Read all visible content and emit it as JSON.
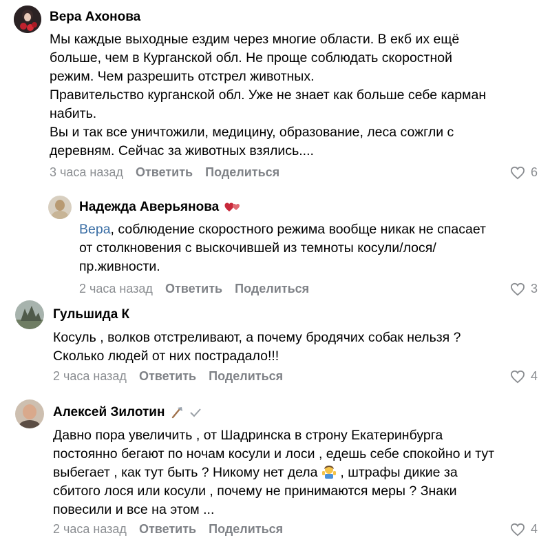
{
  "comments": [
    {
      "author": "Вера Ахонова",
      "lines": [
        "Мы каждые выходные ездим через многие области. В екб их ещё",
        "больше, чем в Курганской обл. Не проще соблюдать скоростной",
        "режим. Чем разрешить отстрел животных.",
        "Правительство курганской обл. Уже не знает как больше себе карман",
        "набить.",
        "Вы и так все уничтожили, медицину, образование, леса сожгли с",
        "деревням. Сейчас за животных взялись...."
      ],
      "time": "3 часа назад",
      "reply": "Ответить",
      "share": "Поделиться",
      "likes": "6"
    },
    {
      "author": "Надежда Аверьянова",
      "mention": "Вера",
      "lines": [
        ", соблюдение скоростного режима вообще никак не спасает",
        "от столкновения с выскочившей из темноты косули/лося/",
        "пр.живности."
      ],
      "time": "2 часа назад",
      "reply": "Ответить",
      "share": "Поделиться",
      "likes": "3",
      "badge_icon": "hearts-icon"
    },
    {
      "author": "Гульшида К",
      "lines": [
        "Косуль , волков отстреливают, а почему бродячих собак нельзя ?",
        "Сколько людей от них пострадало!!!"
      ],
      "time": "2 часа назад",
      "reply": "Ответить",
      "share": "Поделиться",
      "likes": "4"
    },
    {
      "author": "Алексей Зилотин",
      "lines": [
        "Давно пора увеличить , от Шадринска в строну Екатеринбурга",
        "постоянно бегают по ночам косули и лоси , едешь себе спокойно и тут",
        "выбегает , как тут быть ? Никому нет дела",
        "сбитого лося или косули , почему не принимаются меры ? Знаки",
        "повесили и все на этом ..."
      ],
      "line3_suffix": ", штрафы дикие за",
      "time": "2 часа назад",
      "reply": "Ответить",
      "share": "Поделиться",
      "likes": "4",
      "badge_icon": "axe-icon",
      "verified_icon": "checkmark-icon"
    }
  ],
  "colors": {
    "mention": "#3a6ea5",
    "meta": "#8a8d91"
  }
}
